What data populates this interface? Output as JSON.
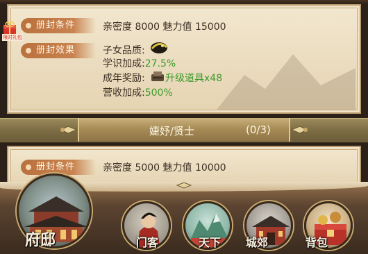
{
  "section1": {
    "condition_label": "册封条件",
    "condition_text": "亲密度 8000  魅力值 15000",
    "effect_label": "册封效果",
    "child_quality_label": "子女品质:",
    "study_bonus_label": "学识加成:",
    "study_bonus_value": "27.5%",
    "adult_reward_label": "成年奖励:",
    "adult_reward_value": "升级道具x48",
    "revenue_bonus_label": "营收加成:",
    "revenue_bonus_value": "500%"
  },
  "banner": {
    "title": "婕妤/贤士",
    "count": "(0/3)"
  },
  "section2": {
    "condition_label": "册封条件",
    "condition_text": "亲密度 5000  魅力值 10000"
  },
  "gift": {
    "icon": "gift-icon",
    "label": "限时礼包"
  },
  "nav": {
    "items": [
      {
        "label": "府邸",
        "icon": "mansion-icon"
      },
      {
        "label": "门客",
        "icon": "retainer-icon"
      },
      {
        "label": "天下",
        "icon": "world-icon"
      },
      {
        "label": "城郊",
        "icon": "suburb-icon"
      },
      {
        "label": "背包",
        "icon": "bag-icon"
      }
    ]
  },
  "colors": {
    "highlight_green": "#3e9b2c",
    "label_tag": "#c98350",
    "parchment": "#f2e7cf"
  }
}
